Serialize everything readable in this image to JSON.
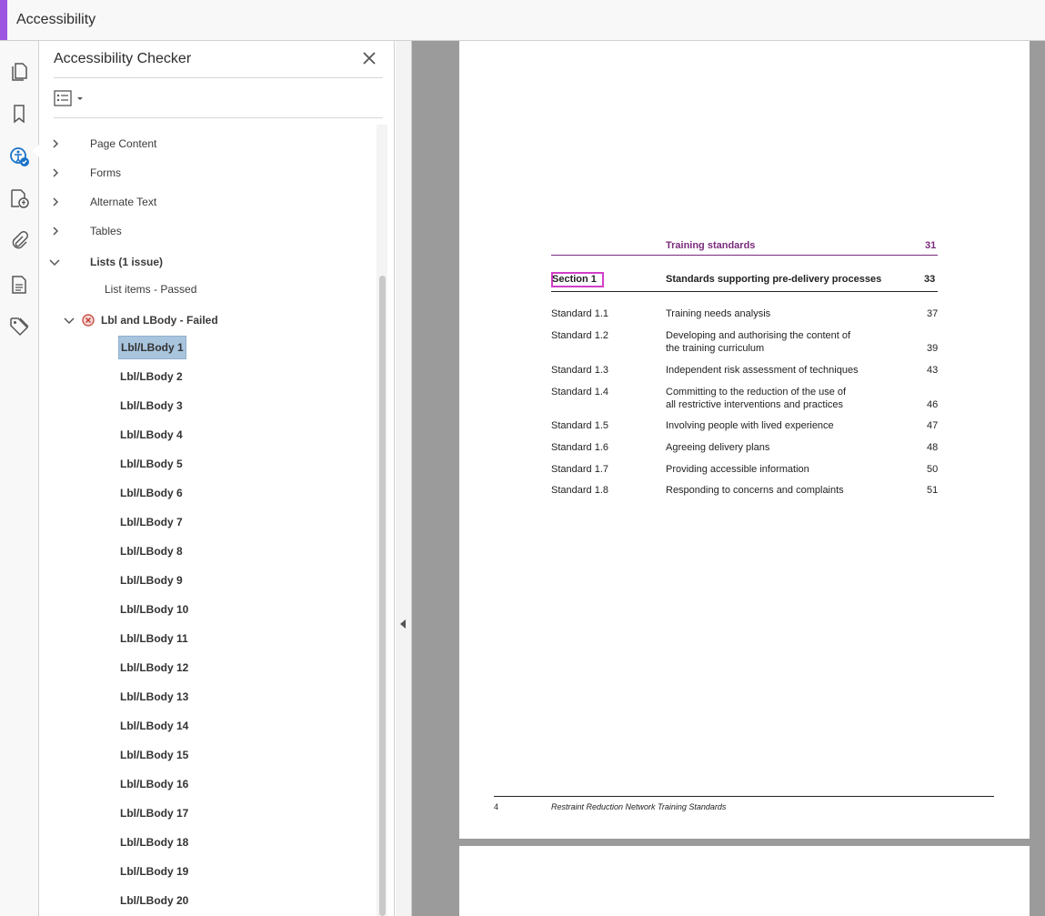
{
  "app": {
    "title": "Accessibility"
  },
  "rail": {
    "icons": [
      "pages-icon",
      "bookmark-icon",
      "accessibility-checker-icon",
      "accessibility-tags-icon",
      "attachment-icon",
      "document-properties-icon",
      "tags-icon"
    ]
  },
  "panel": {
    "title": "Accessibility Checker",
    "categories": [
      {
        "label": "Page Content"
      },
      {
        "label": "Forms"
      },
      {
        "label": "Alternate Text"
      },
      {
        "label": "Tables"
      },
      {
        "label": "Lists (1 issue)"
      }
    ],
    "list_items_passed": "List items - Passed",
    "failed_rule": "Lbl and LBody - Failed",
    "lbl_items": [
      "Lbl/LBody 1",
      "Lbl/LBody 2",
      "Lbl/LBody 3",
      "Lbl/LBody 4",
      "Lbl/LBody 5",
      "Lbl/LBody 6",
      "Lbl/LBody 7",
      "Lbl/LBody 8",
      "Lbl/LBody 9",
      "Lbl/LBody 10",
      "Lbl/LBody 11",
      "Lbl/LBody 12",
      "Lbl/LBody 13",
      "Lbl/LBody 14",
      "Lbl/LBody 15",
      "Lbl/LBody 16",
      "Lbl/LBody 17",
      "Lbl/LBody 18",
      "Lbl/LBody 19",
      "Lbl/LBody 20"
    ]
  },
  "document": {
    "header": {
      "title": "Training standards",
      "page": "31"
    },
    "section": {
      "label": "Section 1",
      "title": "Standards supporting pre-delivery processes",
      "page": "33"
    },
    "entries": [
      {
        "num": "Standard 1.1",
        "line1": "Training needs analysis",
        "line2": "",
        "page": "37"
      },
      {
        "num": "Standard 1.2",
        "line1": "Developing and authorising the content of",
        "line2": "the training curriculum",
        "page": "39"
      },
      {
        "num": "Standard 1.3",
        "line1": "Independent risk assessment of techniques",
        "line2": "",
        "page": "43"
      },
      {
        "num": "Standard 1.4",
        "line1": "Committing to the reduction of the use of",
        "line2": "all restrictive interventions and practices",
        "page": "46"
      },
      {
        "num": "Standard 1.5",
        "line1": "Involving people with lived experience",
        "line2": "",
        "page": "47"
      },
      {
        "num": "Standard 1.6",
        "line1": "Agreeing delivery plans",
        "line2": "",
        "page": "48"
      },
      {
        "num": "Standard 1.7",
        "line1": "Providing accessible information",
        "line2": "",
        "page": "50"
      },
      {
        "num": "Standard 1.8",
        "line1": "Responding to concerns and complaints",
        "line2": "",
        "page": "51"
      }
    ],
    "footer": {
      "page": "4",
      "text": "Restraint Reduction Network Training Standards"
    }
  },
  "colors": {
    "accent": "#9b55e0",
    "heading_purple": "#7a2a7c",
    "selection": "#a9c4dd",
    "focus_box": "#d23fc8"
  }
}
